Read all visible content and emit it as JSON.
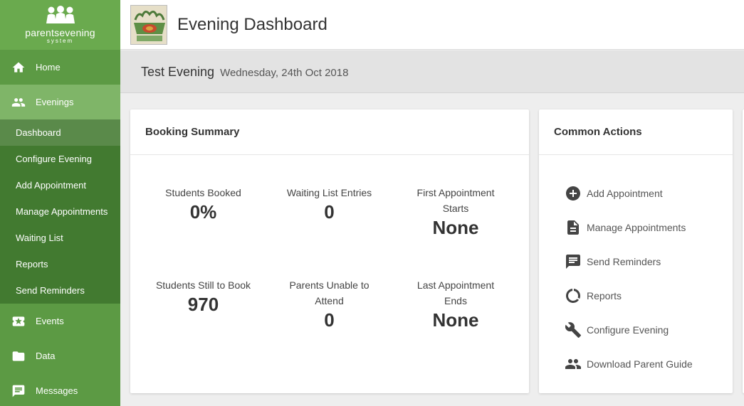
{
  "brand": {
    "name": "parentsevening",
    "sub": "system"
  },
  "nav": {
    "home": "Home",
    "evenings": "Evenings",
    "evening_items": [
      "Dashboard",
      "Configure Evening",
      "Add Appointment",
      "Manage Appointments",
      "Waiting List",
      "Reports",
      "Send Reminders"
    ],
    "events": "Events",
    "data": "Data",
    "messages": "Messages"
  },
  "header": {
    "title": "Evening Dashboard"
  },
  "evening": {
    "name": "Test Evening",
    "date": "Wednesday, 24th Oct 2018"
  },
  "booking_summary": {
    "title": "Booking Summary",
    "stats": [
      {
        "label": "Students Booked",
        "value": "0%"
      },
      {
        "label": "Waiting List Entries",
        "value": "0"
      },
      {
        "label": "First Appointment Starts",
        "value": "None"
      },
      {
        "label": "Students Still to Book",
        "value": "970"
      },
      {
        "label": "Parents Unable to Attend",
        "value": "0"
      },
      {
        "label": "Last Appointment Ends",
        "value": "None"
      }
    ]
  },
  "common_actions": {
    "title": "Common Actions",
    "items": [
      {
        "label": "Add Appointment",
        "icon": "add-circle-icon"
      },
      {
        "label": "Manage Appointments",
        "icon": "document-icon"
      },
      {
        "label": "Send Reminders",
        "icon": "message-icon"
      },
      {
        "label": "Reports",
        "icon": "donut-chart-icon"
      },
      {
        "label": "Configure Evening",
        "icon": "wrench-icon"
      },
      {
        "label": "Download Parent Guide",
        "icon": "people-icon"
      }
    ]
  },
  "colors": {
    "sidebar": "#5c9a44",
    "sidebar_brand": "#6aaa4e",
    "sidebar_active": "#7fb568",
    "subnav": "#427a30"
  }
}
